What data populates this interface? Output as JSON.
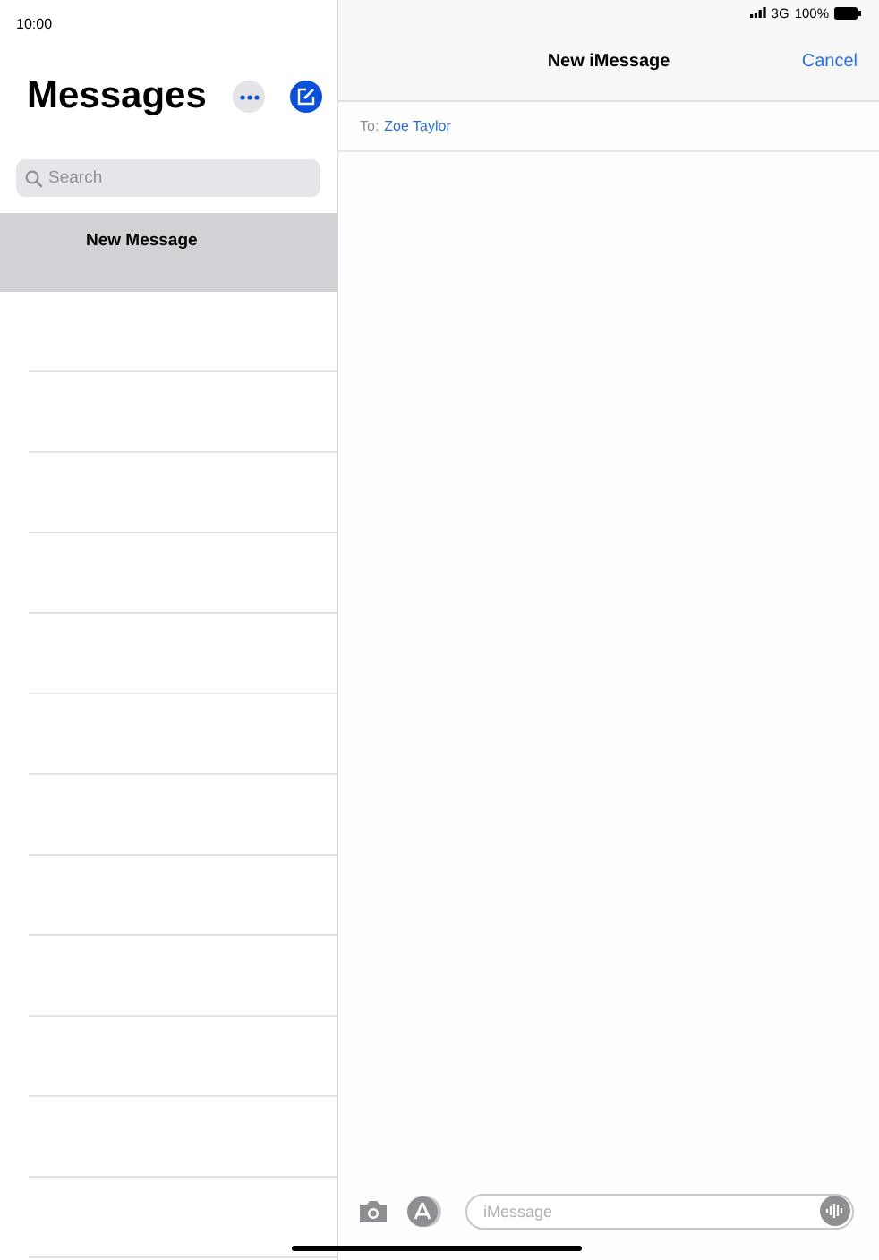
{
  "status_bar": {
    "time": "10:00",
    "network": "3G",
    "battery": "100%"
  },
  "sidebar": {
    "title": "Messages",
    "search": {
      "placeholder": "Search"
    },
    "items": [
      {
        "label": "New Message",
        "selected": true
      }
    ]
  },
  "compose": {
    "title": "New iMessage",
    "cancel": "Cancel",
    "to_label": "To:",
    "recipient": "Zoe Taylor",
    "message": {
      "placeholder": "iMessage"
    }
  }
}
